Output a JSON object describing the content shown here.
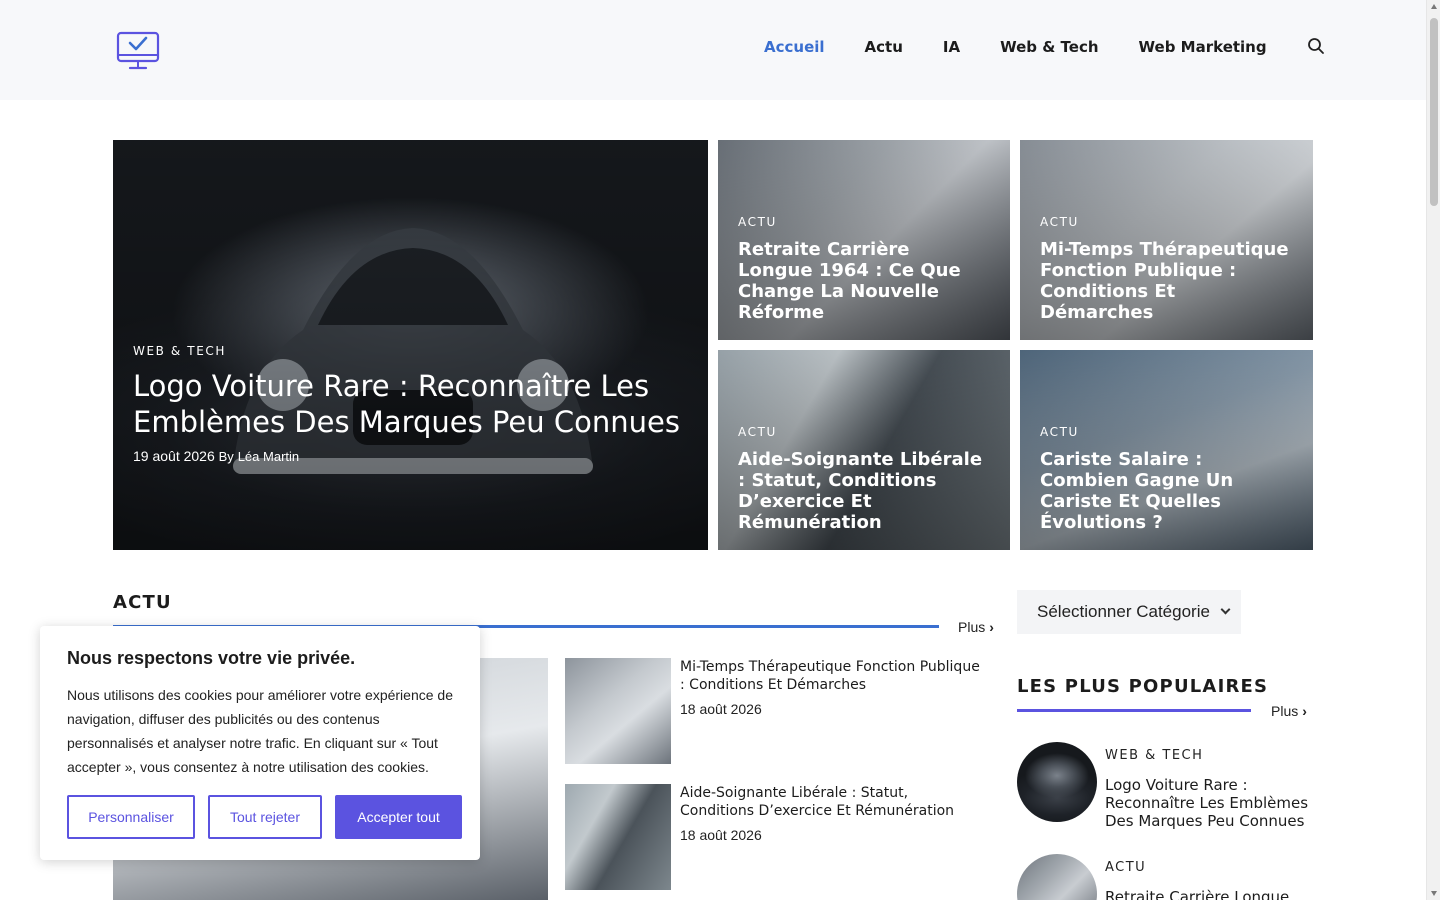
{
  "colors": {
    "nav_active": "#3a6fd0",
    "accent_line": "#3a6fd0",
    "popular_line": "#5b53e0",
    "cookie_accent": "#5b53e0"
  },
  "header": {
    "logo_icon": "monitor-check-icon",
    "nav": [
      {
        "label": "Accueil",
        "active": true
      },
      {
        "label": "Actu"
      },
      {
        "label": "IA"
      },
      {
        "label": "Web & Tech"
      },
      {
        "label": "Web Marketing"
      }
    ],
    "search_icon": "search-icon"
  },
  "hero": {
    "main": {
      "category": "WEB & TECH",
      "title": "Logo Voiture Rare : Reconnaître Les Emblèmes Des Marques Peu Connues",
      "date": "19 août 2026",
      "by": "By",
      "author": "Léa Martin"
    },
    "cards": [
      {
        "category": "ACTU",
        "title": "Retraite Carrière Longue 1964 : Ce Que Change La Nouvelle Réforme"
      },
      {
        "category": "ACTU",
        "title": "Mi-Temps Thérapeutique Fonction Publique : Conditions Et Démarches"
      },
      {
        "category": "ACTU",
        "title": "Aide-Soignante Libérale : Statut, Conditions D’exercice Et Rémunération"
      },
      {
        "category": "ACTU",
        "title": "Cariste Salaire : Combien Gagne Un Cariste Et Quelles Évolutions ?"
      }
    ]
  },
  "actu": {
    "title": "ACTU",
    "more": "Plus",
    "list": [
      {
        "title": "Mi-Temps Thérapeutique Fonction Publique : Conditions Et Démarches",
        "date": "18 août 2026"
      },
      {
        "title": "Aide-Soignante Libérale : Statut, Conditions D’exercice Et Rémunération",
        "date": "18 août 2026"
      }
    ]
  },
  "sidebar": {
    "select_label": "Sélectionner Catégorie",
    "popular": {
      "title": "LES PLUS POPULAIRES",
      "more": "Plus",
      "items": [
        {
          "category": "WEB & TECH",
          "title": "Logo Voiture Rare : Reconnaître Les Emblèmes Des Marques Peu Connues"
        },
        {
          "category": "ACTU",
          "title": "Retraite Carrière Longue"
        }
      ]
    }
  },
  "cookie": {
    "title": "Nous respectons votre vie privée.",
    "text": "Nous utilisons des cookies pour améliorer votre expérience de navigation, diffuser des publicités ou des contenus personnalisés et analyser notre trafic. En cliquant sur « Tout accepter », vous consentez à notre utilisation des cookies.",
    "customize": "Personnaliser",
    "reject": "Tout rejeter",
    "accept": "Accepter tout"
  }
}
